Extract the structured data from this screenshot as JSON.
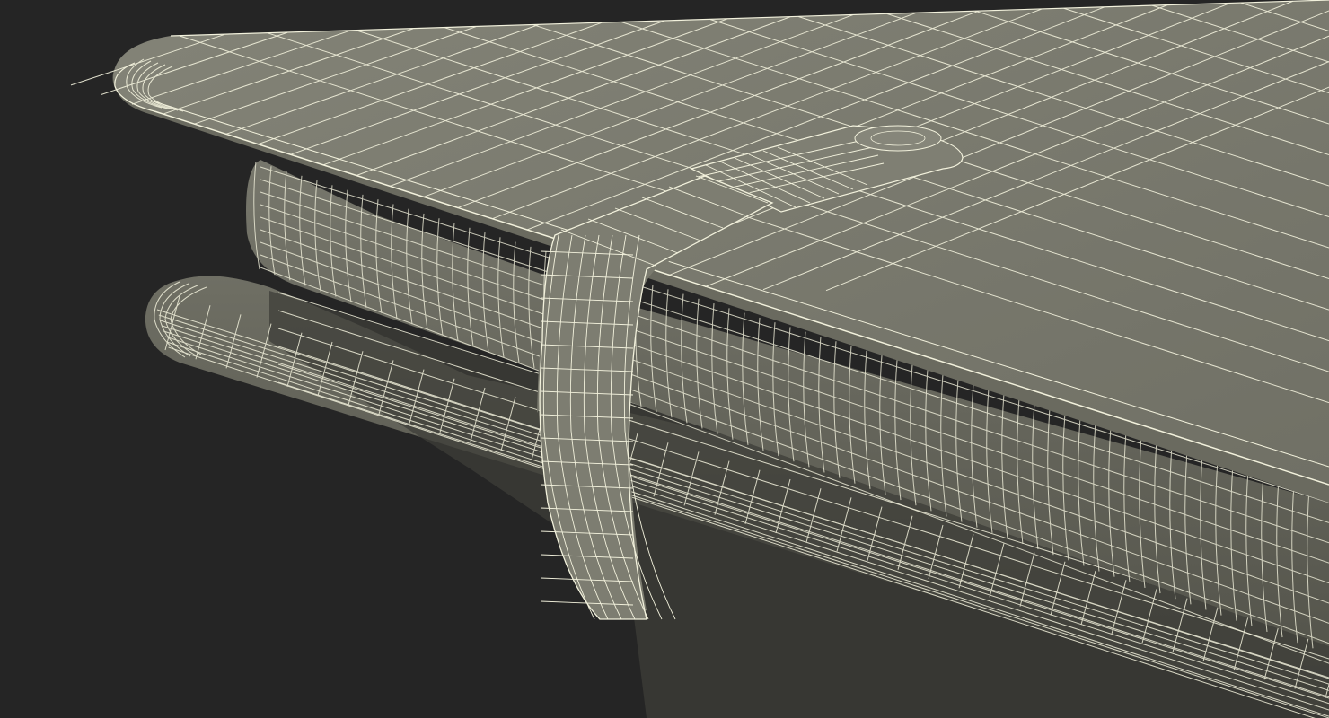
{
  "scene": {
    "subject": "notebook-wireframe-render",
    "colors": {
      "background": "#252525",
      "cover": "#7c7c70",
      "cover_dark": "#5d5d52",
      "pages": "#6e6e64",
      "pages_shadow": "#4f4f47",
      "bottom_cover": "#6a6a5f",
      "inner_shadow": "#3b3b35",
      "strap": "#7a7a6e",
      "wire": "#f2f1dc"
    }
  }
}
